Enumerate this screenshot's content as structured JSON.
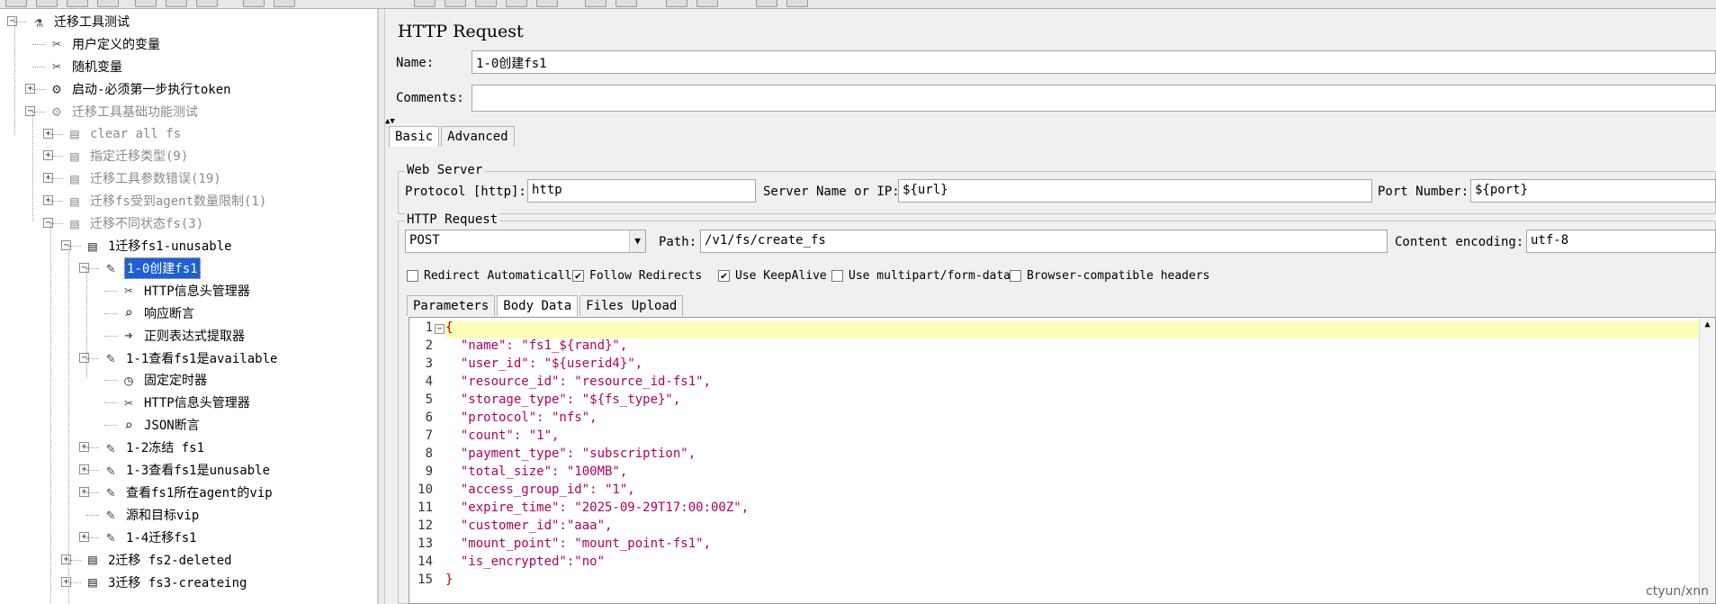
{
  "tree": {
    "items": [
      {
        "label": "迁移工具测试",
        "icon": "flask-icon",
        "expander": "−",
        "state": "normal"
      },
      {
        "label": "用户定义的变量",
        "icon": "wrench-icon",
        "expander": "",
        "state": "normal"
      },
      {
        "label": "随机变量",
        "icon": "wrench-icon",
        "expander": "",
        "state": "normal"
      },
      {
        "label": "启动-必须第一步执行token",
        "icon": "gear-icon",
        "expander": "+",
        "state": "normal"
      },
      {
        "label": "迁移工具基础功能测试",
        "icon": "gear-icon",
        "expander": "−",
        "state": "disabled"
      },
      {
        "label": "clear all fs",
        "icon": "controller-icon",
        "expander": "+",
        "state": "disabled"
      },
      {
        "label": "指定迁移类型(9)",
        "icon": "controller-icon",
        "expander": "+",
        "state": "disabled"
      },
      {
        "label": "迁移工具参数错误(19)",
        "icon": "controller-icon",
        "expander": "+",
        "state": "disabled"
      },
      {
        "label": "迁移fs受到agent数量限制(1)",
        "icon": "controller-icon",
        "expander": "+",
        "state": "disabled"
      },
      {
        "label": "迁移不同状态fs(3)",
        "icon": "controller-icon",
        "expander": "−",
        "state": "disabled"
      },
      {
        "label": "1迁移fs1-unusable",
        "icon": "controller-icon",
        "expander": "−",
        "state": "normal"
      },
      {
        "label": "1-0创建fs1",
        "icon": "sampler-icon",
        "expander": "−",
        "state": "selected"
      },
      {
        "label": "HTTP信息头管理器",
        "icon": "wrench-icon",
        "expander": "",
        "state": "normal"
      },
      {
        "label": "响应断言",
        "icon": "magnifier-icon",
        "expander": "",
        "state": "normal"
      },
      {
        "label": "正则表达式提取器",
        "icon": "extractor-icon",
        "expander": "",
        "state": "normal"
      },
      {
        "label": "1-1查看fs1是available",
        "icon": "sampler-icon",
        "expander": "−",
        "state": "normal"
      },
      {
        "label": "固定定时器",
        "icon": "timer-icon",
        "expander": "",
        "state": "normal"
      },
      {
        "label": "HTTP信息头管理器",
        "icon": "wrench-icon",
        "expander": "",
        "state": "normal"
      },
      {
        "label": "JSON断言",
        "icon": "magnifier-icon",
        "expander": "",
        "state": "normal"
      },
      {
        "label": "1-2冻结 fs1",
        "icon": "sampler-icon",
        "expander": "+",
        "state": "normal"
      },
      {
        "label": "1-3查看fs1是unusable",
        "icon": "sampler-icon",
        "expander": "+",
        "state": "normal"
      },
      {
        "label": "查看fs1所在agent的vip",
        "icon": "sampler-icon",
        "expander": "+",
        "state": "normal"
      },
      {
        "label": "源和目标vip",
        "icon": "sampler-icon",
        "expander": "",
        "state": "normal"
      },
      {
        "label": "1-4迁移fs1",
        "icon": "sampler-icon",
        "expander": "+",
        "state": "normal"
      },
      {
        "label": "2迁移 fs2-deleted",
        "icon": "controller-icon",
        "expander": "+",
        "state": "normal"
      },
      {
        "label": "3迁移 fs3-createing",
        "icon": "controller-icon",
        "expander": "+",
        "state": "normal"
      }
    ]
  },
  "panel": {
    "title": "HTTP Request",
    "name_label": "Name:",
    "name_value": "1-0创建fs1",
    "comments_label": "Comments:",
    "comments_value": "",
    "tabs": [
      "Basic",
      "Advanced"
    ],
    "web_server": {
      "legend": "Web Server",
      "protocol_label": "Protocol [http]:",
      "protocol_value": "http",
      "server_label": "Server Name or IP:",
      "server_value": "${url}",
      "port_label": "Port Number:",
      "port_value": "${port}"
    },
    "http_request": {
      "legend": "HTTP Request",
      "method": "POST",
      "path_label": "Path:",
      "path_value": "/v1/fs/create_fs",
      "encoding_label": "Content encoding:",
      "encoding_value": "utf-8"
    },
    "options": [
      {
        "label": "Redirect Automatically",
        "checked": false
      },
      {
        "label": "Follow Redirects",
        "checked": true
      },
      {
        "label": "Use KeepAlive",
        "checked": true
      },
      {
        "label": "Use multipart/form-data",
        "checked": false
      },
      {
        "label": "Browser-compatible headers",
        "checked": false
      }
    ],
    "subtabs": [
      "Parameters",
      "Body Data",
      "Files Upload"
    ],
    "body_lines": [
      "{",
      "  \"name\": \"fs1_${rand}\",",
      "  \"user_id\": \"${userid4}\",",
      "  \"resource_id\": \"resource_id-fs1\",",
      "  \"storage_type\": \"${fs_type}\",",
      "  \"protocol\": \"nfs\",",
      "  \"count\": \"1\",",
      "  \"payment_type\": \"subscription\",",
      "  \"total_size\": \"100MB\",",
      "  \"access_group_id\": \"1\",",
      "  \"expire_time\": \"2025-09-29T17:00:00Z\",",
      "  \"customer_id\":\"aaa\",",
      "  \"mount_point\": \"mount_point-fs1\",",
      "  \"is_encrypted\":\"no\"",
      "}"
    ]
  },
  "watermark": "ctyun/xnn",
  "colors": {
    "selection": "#1e5fd6",
    "code_text": "#b00060",
    "current_line": "#fdfdb8"
  }
}
